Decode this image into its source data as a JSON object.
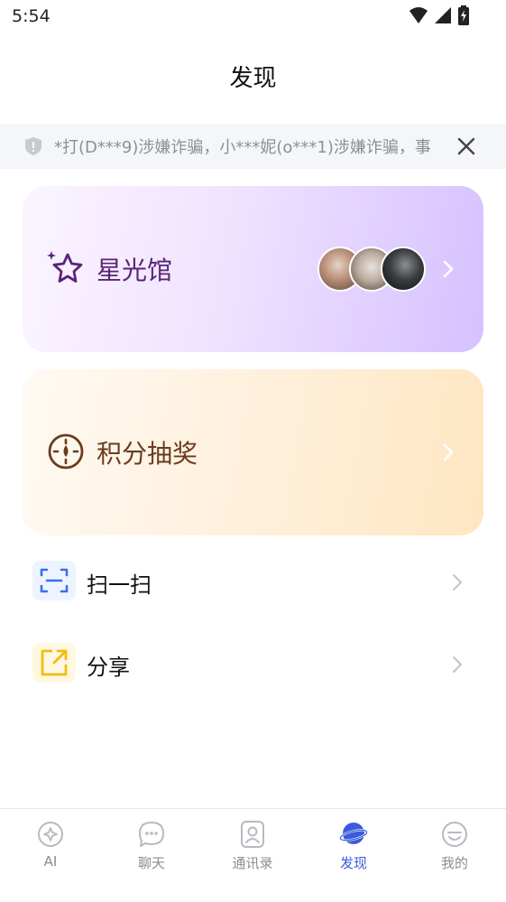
{
  "status_bar": {
    "time": "5:54"
  },
  "header": {
    "title": "发现"
  },
  "notice": {
    "text": "*打(D***9)涉嫌诈骗，小***妮(o***1)涉嫌诈骗，事"
  },
  "cards": [
    {
      "label": "星光馆",
      "icon": "sparkle-star-icon"
    },
    {
      "label": "积分抽奖",
      "icon": "lottery-dial-icon"
    }
  ],
  "rows": [
    {
      "label": "扫一扫",
      "icon": "scan-icon"
    },
    {
      "label": "分享",
      "icon": "share-icon"
    }
  ],
  "tabs": [
    {
      "label": "AI",
      "icon": "ai-icon"
    },
    {
      "label": "聊天",
      "icon": "chat-icon"
    },
    {
      "label": "通讯录",
      "icon": "contacts-icon"
    },
    {
      "label": "发现",
      "icon": "discover-planet-icon",
      "active": true
    },
    {
      "label": "我的",
      "icon": "profile-icon"
    }
  ],
  "colors": {
    "accent": "#3b5bdb",
    "star_label": "#5a2478",
    "lottery_label": "#6a3c1d"
  }
}
